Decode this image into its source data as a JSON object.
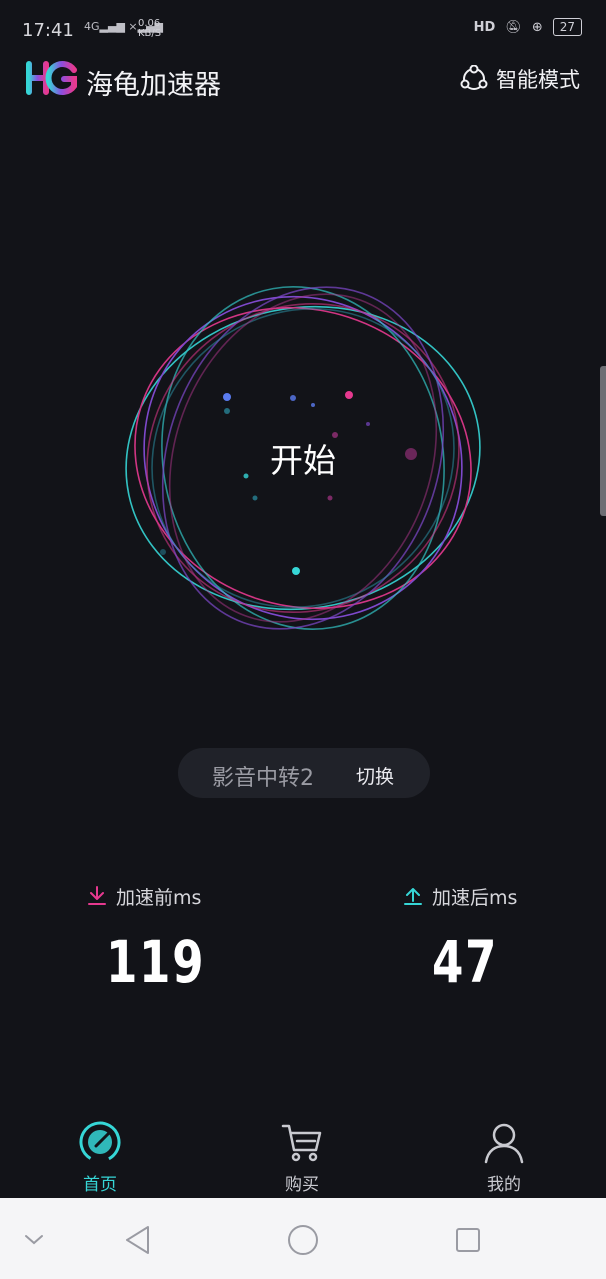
{
  "status_bar": {
    "time": "17:41",
    "signal": "4G",
    "net_speed_value": "0.06",
    "net_speed_unit": "KB/S",
    "hd_badge": "HD",
    "battery": "27"
  },
  "app": {
    "title": "海龟加速器",
    "mode_label": "智能模式"
  },
  "accelerator": {
    "start_label": "开始",
    "server_name": "影音中转2",
    "switch_label": "切换"
  },
  "stats": {
    "before_label": "加速前ms",
    "before_value": "119",
    "after_label": "加速后ms",
    "after_value": "47"
  },
  "nav": {
    "home": "首页",
    "buy": "购买",
    "mine": "我的"
  },
  "colors": {
    "background": "#121318",
    "accent_cyan": "#36d6d6",
    "accent_pink": "#e6398f",
    "accent_purple": "#8a4fe0",
    "pill": "#202229"
  },
  "icons": {
    "mode": "molecule-icon",
    "down": "arrow-down-icon",
    "up": "arrow-up-icon",
    "home": "speedometer-icon",
    "buy": "cart-icon",
    "mine": "user-icon",
    "sys_back": "triangle-back-icon",
    "sys_home": "circle-home-icon",
    "sys_recent": "square-recent-icon"
  }
}
